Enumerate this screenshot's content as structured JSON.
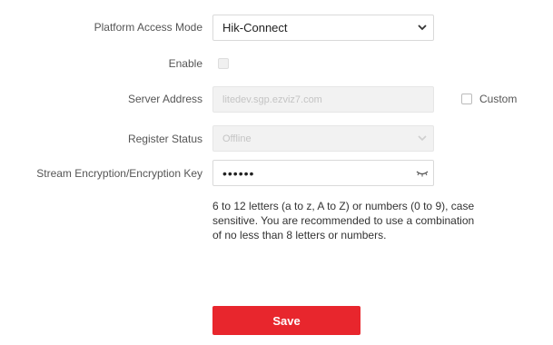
{
  "form": {
    "platform_access_mode": {
      "label": "Platform Access Mode",
      "value": "Hik-Connect"
    },
    "enable": {
      "label": "Enable"
    },
    "server_address": {
      "label": "Server Address",
      "value": "litedev.sgp.ezviz7.com"
    },
    "custom": {
      "label": "Custom"
    },
    "register_status": {
      "label": "Register Status",
      "value": "Offline"
    },
    "stream_encryption": {
      "label": "Stream Encryption/Encryption Key",
      "value": "••••••"
    },
    "hint": "6 to 12 letters (a to z, A to Z) or numbers (0 to 9), case sensitive. You are recommended to use a combination of no less than 8 letters or numbers.",
    "save_label": "Save"
  },
  "colors": {
    "accent": "#e8262d",
    "disabled_bg": "#f2f2f2",
    "border": "#d9d9d9"
  },
  "icons": {
    "select": "chevron-down-icon",
    "password": "eye-closed-icon"
  }
}
